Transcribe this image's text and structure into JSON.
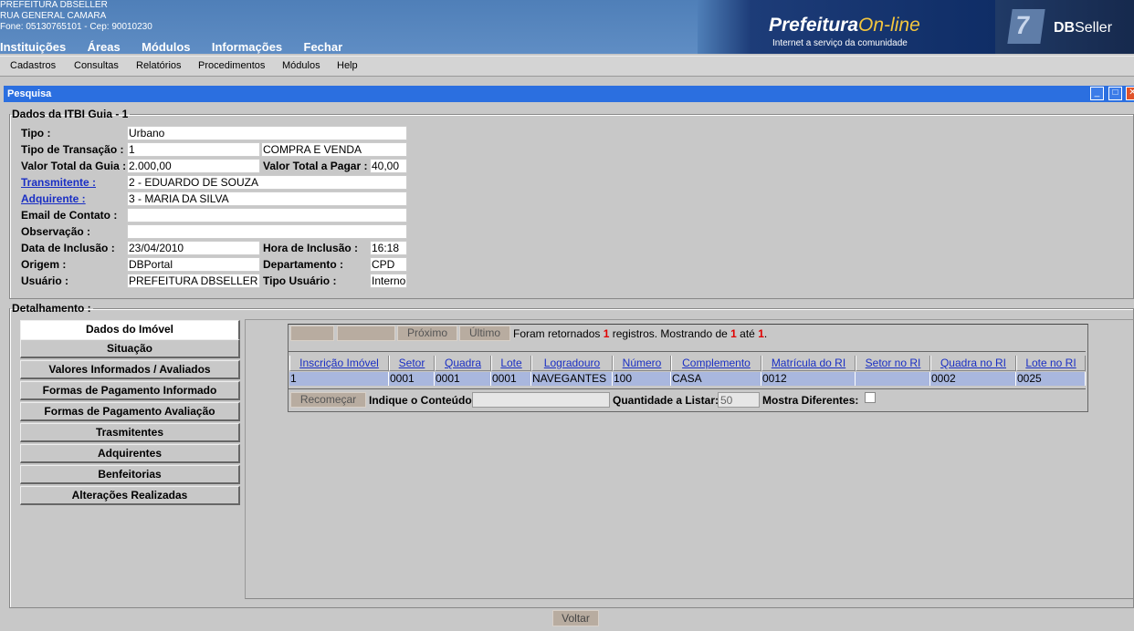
{
  "header": {
    "entity": "PREFEITURA DBSELLER",
    "address": "RUA GENERAL CAMARA",
    "contact": "Fone: 05130765101  -  Cep: 90010230",
    "nav": [
      "Instituições",
      "Áreas",
      "Módulos",
      "Informações",
      "Fechar"
    ],
    "brand_name": "Prefeitura",
    "brand_online": "On-line",
    "brand_tagline": "Internet a serviço da comunidade",
    "partner_bold": "DB",
    "partner_light": "Seller"
  },
  "menubar": [
    "Cadastros",
    "Consultas",
    "Relatórios",
    "Procedimentos",
    "Módulos",
    "Help"
  ],
  "window": {
    "title": "Pesquisa",
    "minimize": "_",
    "maximize": "□",
    "close": "✕"
  },
  "itbi": {
    "legend": "Dados da ITBI Guia - 1",
    "tipo_label": "Tipo :",
    "tipo": "Urbano",
    "transacao_label": "Tipo de Transação :",
    "transacao_code": "1",
    "transacao_desc": "COMPRA E VENDA",
    "valor_total_label": "Valor Total da Guia :",
    "valor_total": "2.000,00",
    "valor_pagar_label": "Valor Total a Pagar :",
    "valor_pagar": "40,00",
    "transmitente_label": "Transmitente :",
    "transmitente": "2 - EDUARDO DE SOUZA",
    "adquirente_label": "Adquirente :",
    "adquirente": "3 - MARIA DA SILVA",
    "email_label": "Email de Contato :",
    "email": "",
    "obs_label": "Observação :",
    "obs": "",
    "data_label": "Data de Inclusão :",
    "data": "23/04/2010",
    "hora_label": "Hora de Inclusão :",
    "hora": "16:18",
    "origem_label": "Origem :",
    "origem": "DBPortal",
    "depto_label": "Departamento :",
    "depto": "CPD",
    "usuario_label": "Usuário :",
    "usuario": "PREFEITURA DBSELLER",
    "tipo_usuario_label": "Tipo Usuário :",
    "tipo_usuario": "Interno"
  },
  "detalhamento": {
    "legend": "Detalhamento :",
    "tabs": [
      "Dados do Imóvel",
      "Situação",
      "Valores Informados / Avaliados",
      "Formas de Pagamento Informado",
      "Formas de Pagamento Avaliação",
      "Trasmitentes",
      "Adquirentes",
      "Benfeitorias",
      "Alterações Realizadas"
    ]
  },
  "grid": {
    "nav_first": "",
    "nav_prev": "",
    "nav_next": "Próximo",
    "nav_last": "Último",
    "status_a": "Foram retornados ",
    "status_count": "1",
    "status_b": " registros. Mostrando de ",
    "status_from": "1",
    "status_c": " até ",
    "status_to": "1",
    "status_d": ".",
    "columns": [
      "Inscrição Imóvel",
      "Setor",
      "Quadra",
      "Lote",
      "Logradouro",
      "Número",
      "Complemento",
      "Matrícula do RI",
      "Setor no RI",
      "Quadra no RI",
      "Lote no RI"
    ],
    "row": [
      "1",
      "0001",
      "0001",
      "0001",
      "NAVEGANTES",
      "100",
      "CASA",
      "0012",
      "",
      "0002",
      "0025"
    ],
    "recomecar": "Recomeçar",
    "conteudo_label": "Indique o Conteúdo:",
    "conteudo": "",
    "quantidade_label": "Quantidade a Listar:",
    "quantidade": "50",
    "diferentes_label": "Mostra Diferentes:"
  },
  "footer": {
    "voltar": "Voltar"
  }
}
